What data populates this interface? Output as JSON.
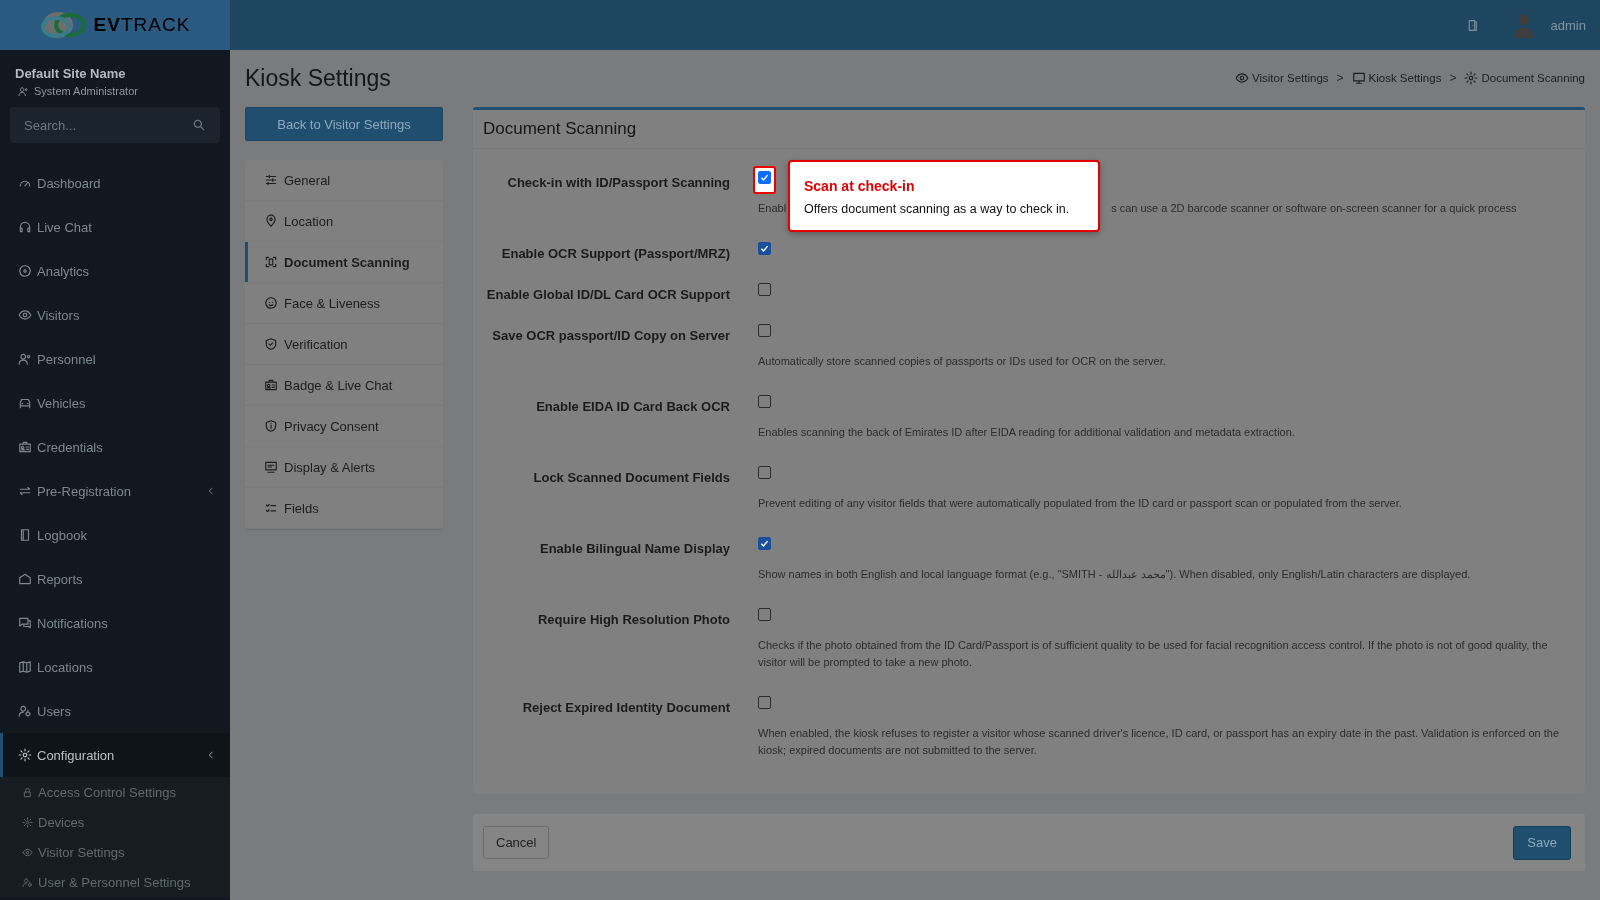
{
  "logo": {
    "text": "**EV**TRACK"
  },
  "top_bar": {
    "user": "admin"
  },
  "sidebar": {
    "site_name": "Default Site Name",
    "role": "System Administrator",
    "search": {
      "placeholder": "Search..."
    },
    "items": [
      {
        "label": "Dashboard",
        "selected": false
      },
      {
        "label": "Live Chat",
        "selected": false
      },
      {
        "label": "Analytics",
        "selected": false
      },
      {
        "label": "Visitors",
        "selected": false
      },
      {
        "label": "Personnel",
        "selected": false
      },
      {
        "label": "Vehicles",
        "selected": false
      },
      {
        "label": "Credentials",
        "selected": false
      },
      {
        "label": "Pre-Registration",
        "selected": false,
        "submenu": true
      },
      {
        "label": "Logbook",
        "selected": false
      },
      {
        "label": "Reports",
        "selected": false
      },
      {
        "label": "Notifications",
        "selected": false
      },
      {
        "label": "Locations",
        "selected": false
      },
      {
        "label": "Users",
        "selected": false
      },
      {
        "label": "Configuration",
        "selected": true,
        "submenu": true,
        "children": [
          {
            "label": "Access Control Settings",
            "selected": false
          },
          {
            "label": "Devices",
            "selected": false
          },
          {
            "label": "Visitor Settings",
            "selected": false
          },
          {
            "label": "User & Personnel Settings",
            "selected": false
          }
        ]
      }
    ]
  },
  "page": {
    "title": "Kiosk Settings",
    "back_button": "Back to Visitor Settings",
    "breadcrumbs": [
      {
        "label": "Visitor Settings"
      },
      {
        "separator": ">"
      },
      {
        "label": "Kiosk Settings"
      },
      {
        "separator": ">"
      },
      {
        "label": "Document Scanning"
      }
    ]
  },
  "settings_nav": [
    {
      "label": "General",
      "selected": false
    },
    {
      "label": "Location",
      "selected": false
    },
    {
      "label": "Document Scanning",
      "selected": true
    },
    {
      "label": "Face & Liveness",
      "selected": false
    },
    {
      "label": "Verification",
      "selected": false
    },
    {
      "label": "Badge & Live Chat",
      "selected": false
    },
    {
      "label": "Privacy Consent",
      "selected": false
    },
    {
      "label": "Display & Alerts",
      "selected": false
    },
    {
      "label": "Fields",
      "selected": false
    }
  ],
  "card": {
    "title": "Document Scanning",
    "settings": [
      {
        "label": "Check-in with ID/Passport Scanning",
        "checked": true,
        "highlighted": true,
        "description_parts": [
          "Enabl",
          "s can use a 2D barcode scanner or software on-screen scanner for a quick process"
        ]
      },
      {
        "label": "Enable OCR Support (Passport/MRZ)",
        "checked": true,
        "highlighted": false
      },
      {
        "label": "Enable Global ID/DL Card OCR Support",
        "checked": false,
        "highlighted": false
      },
      {
        "label": "Save OCR passport/ID Copy on Server",
        "checked": false,
        "highlighted": false,
        "description": "Automatically store scanned copies of passports or IDs used for OCR on the server."
      },
      {
        "label": "Enable EIDA ID Card Back OCR",
        "checked": false,
        "highlighted": false,
        "description": "Enables scanning the back of Emirates ID after EIDA reading for additional validation and metadata extraction."
      },
      {
        "label": "Lock Scanned Document Fields",
        "checked": false,
        "highlighted": false,
        "description": "Prevent editing of any visitor fields that were automatically populated from the ID card or passport scan or populated from the server."
      },
      {
        "label": "Enable Bilingual Name Display",
        "checked": true,
        "highlighted": false,
        "description": "Show names in both English and local language format (e.g., \"SMITH - محمد عبدالله\"). When disabled, only English/Latin characters are displayed."
      },
      {
        "label": "Require High Resolution Photo",
        "checked": false,
        "highlighted": false,
        "description": "Checks if the photo obtained from the ID Card/Passport is of sufficient quality to be used for facial recognition access control. If the photo is not of good quality, the visitor will be prompted to take a new photo."
      },
      {
        "label": "Reject Expired Identity Document",
        "checked": false,
        "highlighted": false,
        "description": "When enabled, the kiosk refuses to register a visitor whose scanned driver's licence, ID card, or passport has an expiry date in the past. Validation is enforced on the kiosk; expired documents are not submitted to the server."
      }
    ]
  },
  "footer": {
    "cancel": "Cancel",
    "save": "Save"
  },
  "tour_popover": {
    "title": "Scan at check-in",
    "body": "Offers document scanning as a way to check in."
  }
}
